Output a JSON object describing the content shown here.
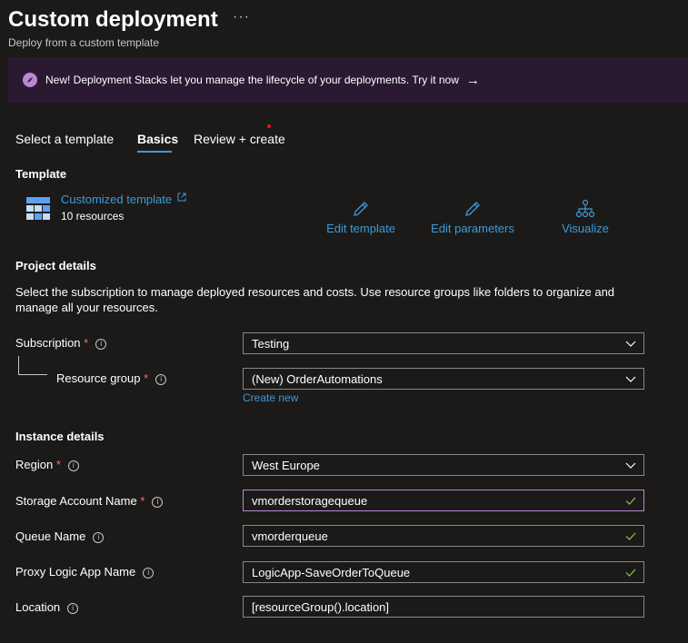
{
  "header": {
    "title": "Custom deployment",
    "more": "···",
    "subtitle": "Deploy from a custom template"
  },
  "banner": {
    "text": "New! Deployment Stacks let you manage the lifecycle of your deployments. Try it now",
    "arrow": "→",
    "accent": "#b788d4"
  },
  "tabs": [
    {
      "label": "Select a template"
    },
    {
      "label": "Basics",
      "active": true
    },
    {
      "label": "Review + create"
    }
  ],
  "template": {
    "heading": "Template",
    "name": "Customized template",
    "resources": "10 resources",
    "actions": {
      "edit_template": "Edit template",
      "edit_parameters": "Edit parameters",
      "visualize": "Visualize"
    }
  },
  "project": {
    "heading": "Project details",
    "description": "Select the subscription to manage deployed resources and costs. Use resource groups like folders to organize and manage all your resources.",
    "subscription": {
      "label": "Subscription",
      "value": "Testing"
    },
    "resource_group": {
      "label": "Resource group",
      "value": "(New) OrderAutomations",
      "create_new": "Create new"
    }
  },
  "instance": {
    "heading": "Instance details",
    "region": {
      "label": "Region",
      "value": "West Europe"
    },
    "storage_account": {
      "label": "Storage Account Name",
      "value": "vmorderstoragequeue"
    },
    "queue_name": {
      "label": "Queue Name",
      "value": "vmorderqueue"
    },
    "proxy_logic_app": {
      "label": "Proxy Logic App Name",
      "value": "LogicApp-SaveOrderToQueue"
    },
    "location": {
      "label": "Location",
      "value": "[resourceGroup().location]"
    }
  },
  "colors": {
    "link": "#3e9ad6",
    "required": "#f1707b",
    "valid": "#92c353"
  }
}
